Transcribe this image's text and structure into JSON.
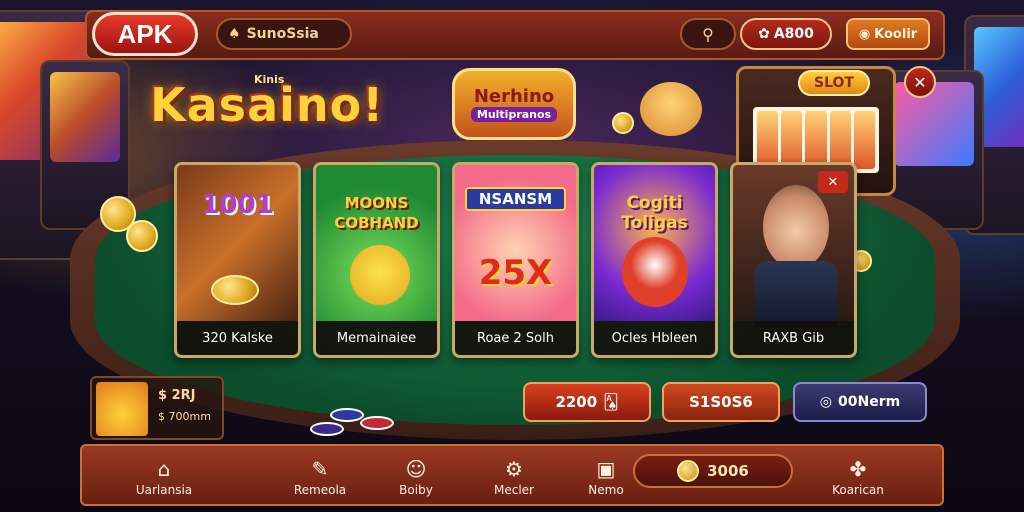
{
  "header": {
    "apk_label": "APK",
    "brand": "SunoSsia",
    "brand_icon": "spade-icon",
    "top_icon": "⚲",
    "balance": "A800",
    "balance_icon": "coin-icon",
    "login_label": "Koolir",
    "login_icon": "account-icon"
  },
  "logo": {
    "main": "Kasaino!",
    "sub": "Kinis",
    "center_line1": "Nerhino",
    "center_line2": "Multipranos",
    "slot_label": "SLOT"
  },
  "cards": [
    {
      "title": "1001",
      "caption": "320 Kalske"
    },
    {
      "title": "MOONS COBHAND",
      "caption": "Memainaiee"
    },
    {
      "title": "NSANSM",
      "big": "25X",
      "caption": "Roae 2 Solh"
    },
    {
      "title": "Cogiti Toligas",
      "caption": "Ocles Hbleen"
    },
    {
      "caption": "RAXB Gib"
    }
  ],
  "promo": {
    "value1": "$ 2RJ",
    "value2": "$ 700mm"
  },
  "bets": {
    "left": "2200",
    "mid": "S1S0S6",
    "right": "00Nerm"
  },
  "nav": {
    "items": [
      {
        "label": "Uarlansia",
        "icon": "home-icon"
      },
      {
        "label": "Remeola",
        "icon": "pencil-icon"
      },
      {
        "label": "Boiby",
        "icon": "face-icon"
      },
      {
        "label": "Mecler",
        "icon": "gear-icon"
      },
      {
        "label": "Nemo",
        "icon": "chat-icon"
      },
      {
        "label": "Koarican",
        "icon": "clover-icon"
      }
    ],
    "coin_value": "3006"
  },
  "colors": {
    "accent": "#9a3a22",
    "gold": "#ffd23a",
    "felt": "#1f8a52"
  }
}
